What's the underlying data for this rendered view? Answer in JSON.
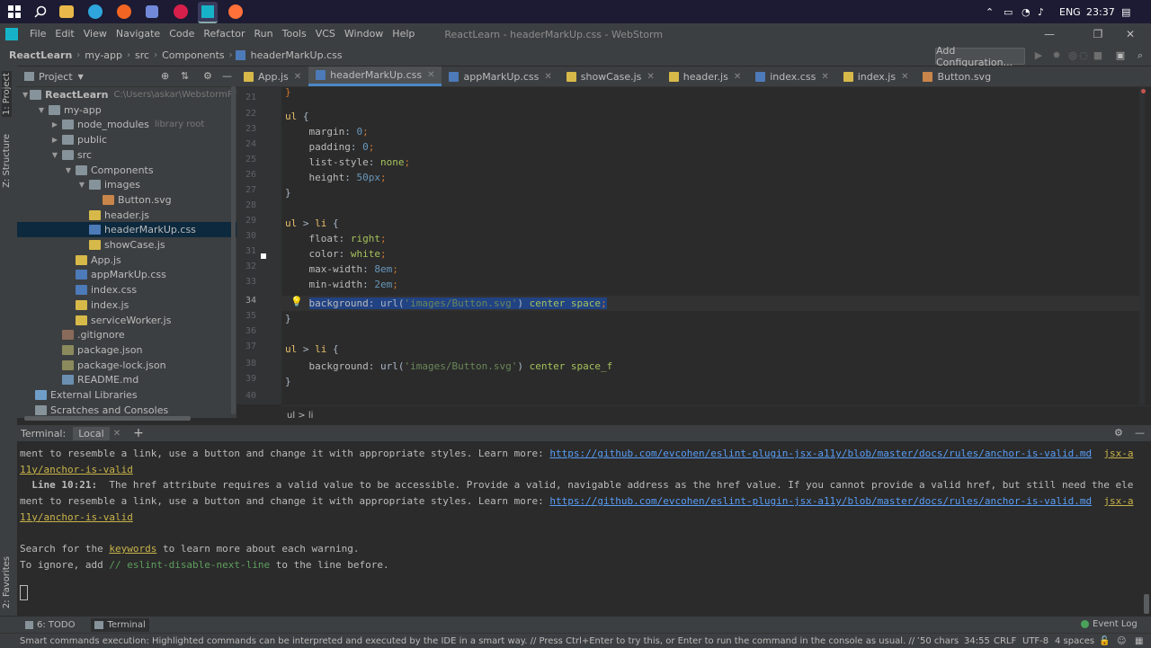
{
  "taskbar": {
    "icons": [
      "windows-start-icon",
      "search-icon",
      "file-explorer-icon",
      "telegram-icon",
      "media-player-icon",
      "discord-icon",
      "opera-icon",
      "webstorm-icon",
      "firefox-icon"
    ],
    "lang": "ENG",
    "time": "23:37"
  },
  "menubar": {
    "items": [
      "File",
      "Edit",
      "View",
      "Navigate",
      "Code",
      "Refactor",
      "Run",
      "Tools",
      "VCS",
      "Window",
      "Help"
    ],
    "title": "ReactLearn - headerMarkUp.css - WebStorm"
  },
  "navbar": {
    "crumbs": [
      "ReactLearn",
      "my-app",
      "src",
      "Components",
      "headerMarkUp.css"
    ],
    "add_config": "Add Configuration..."
  },
  "side_tabs": {
    "project": "1: Project",
    "structure": "Z: Structure",
    "favorites": "2: Favorites"
  },
  "project_panel": {
    "title": "Project",
    "tree": [
      {
        "label": "ReactLearn",
        "hint": "C:\\Users\\askar\\WebstormProjects\\Re",
        "type": "folder",
        "open": true,
        "depth": 0,
        "bold": true
      },
      {
        "label": "my-app",
        "hint": "",
        "type": "folder",
        "open": true,
        "depth": 1
      },
      {
        "label": "node_modules",
        "hint": "library root",
        "type": "folder",
        "open": false,
        "depth": 2
      },
      {
        "label": "public",
        "hint": "",
        "type": "folder",
        "open": false,
        "depth": 2
      },
      {
        "label": "src",
        "hint": "",
        "type": "folder",
        "open": true,
        "depth": 2
      },
      {
        "label": "Components",
        "hint": "",
        "type": "folder",
        "open": true,
        "depth": 3
      },
      {
        "label": "images",
        "hint": "",
        "type": "folder",
        "open": true,
        "depth": 4
      },
      {
        "label": "Button.svg",
        "hint": "",
        "type": "svg",
        "depth": 5
      },
      {
        "label": "header.js",
        "hint": "",
        "type": "js",
        "depth": 4
      },
      {
        "label": "headerMarkUp.css",
        "hint": "",
        "type": "css",
        "depth": 4,
        "selected": true
      },
      {
        "label": "showCase.js",
        "hint": "",
        "type": "js",
        "depth": 4
      },
      {
        "label": "App.js",
        "hint": "",
        "type": "js",
        "depth": 3
      },
      {
        "label": "appMarkUp.css",
        "hint": "",
        "type": "css",
        "depth": 3
      },
      {
        "label": "index.css",
        "hint": "",
        "type": "css",
        "depth": 3
      },
      {
        "label": "index.js",
        "hint": "",
        "type": "js",
        "depth": 3
      },
      {
        "label": "serviceWorker.js",
        "hint": "",
        "type": "js",
        "depth": 3
      },
      {
        "label": ".gitignore",
        "hint": "",
        "type": "git",
        "depth": 2
      },
      {
        "label": "package.json",
        "hint": "",
        "type": "json",
        "depth": 2
      },
      {
        "label": "package-lock.json",
        "hint": "",
        "type": "json",
        "depth": 2
      },
      {
        "label": "README.md",
        "hint": "",
        "type": "md",
        "depth": 2
      },
      {
        "label": "External Libraries",
        "hint": "",
        "type": "lib",
        "depth": 0
      },
      {
        "label": "Scratches and Consoles",
        "hint": "",
        "type": "scratch",
        "depth": 0
      }
    ]
  },
  "tabs": [
    {
      "label": "App.js",
      "type": "js"
    },
    {
      "label": "headerMarkUp.css",
      "type": "css",
      "active": true
    },
    {
      "label": "appMarkUp.css",
      "type": "css"
    },
    {
      "label": "showCase.js",
      "type": "js"
    },
    {
      "label": "header.js",
      "type": "js"
    },
    {
      "label": "index.css",
      "type": "css"
    },
    {
      "label": "index.js",
      "type": "js"
    },
    {
      "label": "Button.svg",
      "type": "svg",
      "noclose": true
    }
  ],
  "editor": {
    "line_numbers": [
      "21",
      "22",
      "23",
      "24",
      "25",
      "26",
      "27",
      "28",
      "29",
      "30",
      "31",
      "32",
      "33",
      "34",
      "35",
      "36",
      "37",
      "38",
      "39",
      "40"
    ],
    "current_line": "34",
    "breadcrumb": "ul > li"
  },
  "terminal": {
    "label": "Terminal:",
    "tab": "Local",
    "lines": [
      {
        "parts": [
          {
            "t": "ment to resemble a link, use a button and change it with appropriate styles. Learn more: "
          },
          {
            "t": "https://github.com/evcohen/eslint-plugin-jsx-a11y/blob/master/docs/rules/anchor-is-valid.md",
            "c": "link"
          },
          {
            "t": "  "
          },
          {
            "t": "jsx-a",
            "c": "ylink"
          }
        ]
      },
      {
        "parts": [
          {
            "t": "11y/anchor-is-valid",
            "c": "ylink"
          }
        ]
      },
      {
        "parts": [
          {
            "t": "  Line 10:21:",
            "c": "bold"
          },
          {
            "t": "  The href attribute requires a valid value to be accessible. Provide a valid, navigable address as the href value. If you cannot provide a valid href, but still need the ele"
          }
        ]
      },
      {
        "parts": [
          {
            "t": "ment to resemble a link, use a button and change it with appropriate styles. Learn more: "
          },
          {
            "t": "https://github.com/evcohen/eslint-plugin-jsx-a11y/blob/master/docs/rules/anchor-is-valid.md",
            "c": "link"
          },
          {
            "t": "  "
          },
          {
            "t": "jsx-a",
            "c": "ylink"
          }
        ]
      },
      {
        "parts": [
          {
            "t": "11y/anchor-is-valid",
            "c": "ylink"
          }
        ]
      },
      {
        "parts": [
          {
            "t": ""
          }
        ]
      },
      {
        "parts": [
          {
            "t": "Search for the "
          },
          {
            "t": "keywords",
            "c": "ylink"
          },
          {
            "t": " to learn more about each warning."
          }
        ]
      },
      {
        "parts": [
          {
            "t": "To ignore, add "
          },
          {
            "t": "// eslint-disable-next-line",
            "c": "green"
          },
          {
            "t": " to the line before."
          }
        ]
      }
    ]
  },
  "bottom_tools": {
    "todo": "6: TODO",
    "terminal": "Terminal",
    "event_log": "Event Log"
  },
  "status": {
    "message": "Smart commands execution: Highlighted commands can be interpreted and executed by the IDE in a smart way. // Press Ctrl+Enter to try this, or Enter to run the command in the console as usual. // You can turn this be... (today",
    "chars": "50 chars",
    "position": "34:55",
    "line_sep": "CRLF",
    "encoding": "UTF-8",
    "indent": "4 spaces"
  }
}
